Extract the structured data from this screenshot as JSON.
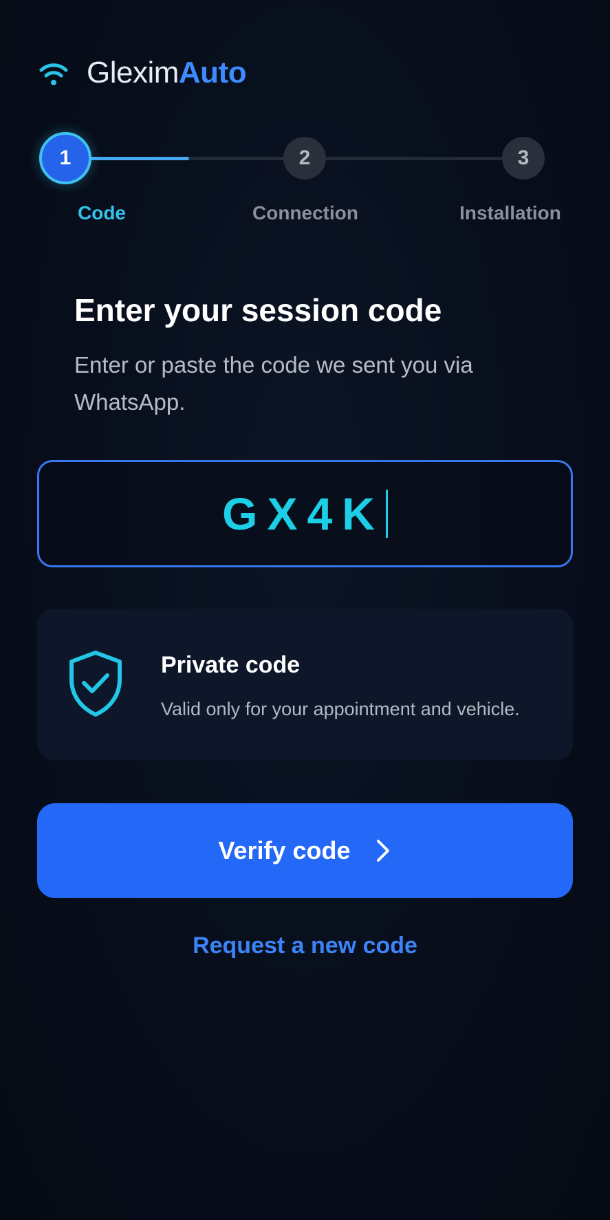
{
  "brand": {
    "name_light": "Glexim",
    "name_bold": "Auto",
    "icon": "wifi-icon"
  },
  "stepper": {
    "current": 1,
    "progress_fraction": 0.27,
    "steps": [
      {
        "number": "1",
        "label": "Code"
      },
      {
        "number": "2",
        "label": "Connection"
      },
      {
        "number": "3",
        "label": "Installation"
      }
    ]
  },
  "content": {
    "title": "Enter your session code",
    "subtitle": "Enter or paste the code we sent you via WhatsApp."
  },
  "code_input": {
    "value": "GX4K"
  },
  "info_card": {
    "icon": "shield-check-icon",
    "title": "Private code",
    "text": "Valid only for your appointment and vehicle."
  },
  "actions": {
    "verify_label": "Verify code",
    "verify_icon": "chevron-right-icon",
    "request_new_label": "Request a new code"
  },
  "colors": {
    "background": "#070d1a",
    "accent": "#2468f7",
    "cyan": "#1ccfe6",
    "link": "#3c83f6"
  }
}
